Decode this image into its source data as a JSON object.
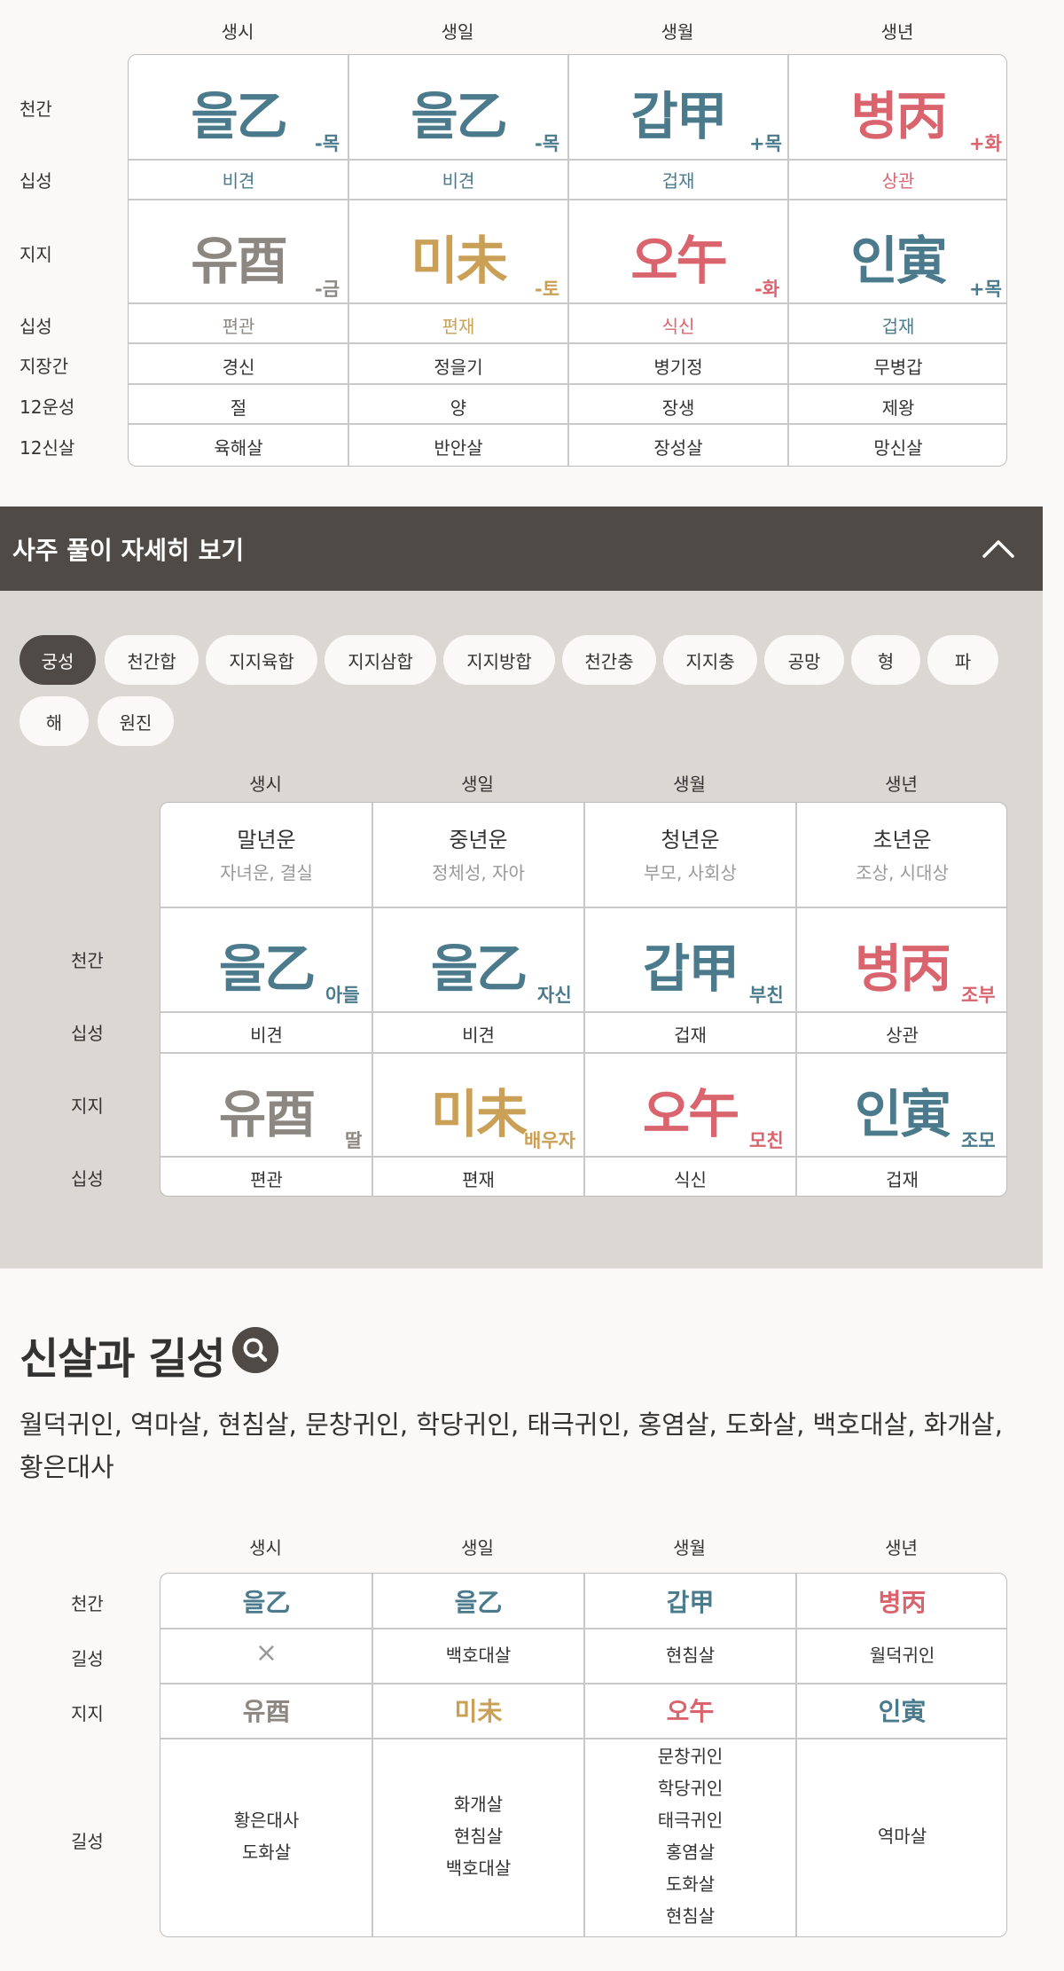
{
  "pillars": [
    "생시",
    "생일",
    "생월",
    "생년"
  ],
  "main_table": {
    "row_labels": [
      "천간",
      "십성",
      "지지",
      "십성",
      "지장간",
      "12운성",
      "12신살"
    ],
    "cheongan": [
      {
        "char": "을乙",
        "tag": "-목",
        "color": "#4a7a8c"
      },
      {
        "char": "을乙",
        "tag": "-목",
        "color": "#4a7a8c"
      },
      {
        "char": "갑甲",
        "tag": "+목",
        "color": "#4a7a8c"
      },
      {
        "char": "병丙",
        "tag": "+화",
        "color": "#d9646e"
      }
    ],
    "cheongan_sipseong": [
      "비견",
      "비견",
      "겁재",
      "상관"
    ],
    "jiji": [
      {
        "char": "유酉",
        "tag": "-금",
        "color": "#8c8780"
      },
      {
        "char": "미未",
        "tag": "-토",
        "color": "#c9a055"
      },
      {
        "char": "오午",
        "tag": "-화",
        "color": "#d9646e"
      },
      {
        "char": "인寅",
        "tag": "+목",
        "color": "#4a7a8c"
      }
    ],
    "jiji_sipseong": [
      "편관",
      "편재",
      "식신",
      "겁재"
    ],
    "jijanggan": [
      "경신",
      "정을기",
      "병기정",
      "무병갑"
    ],
    "unseong": [
      "절",
      "양",
      "장생",
      "제왕"
    ],
    "sinsal": [
      "육해살",
      "반안살",
      "장성살",
      "망신살"
    ]
  },
  "detail": {
    "title": "사주 풀이 자세히 보기",
    "chevron_icon": "chevron-up-icon",
    "chips": [
      "궁성",
      "천간합",
      "지지육합",
      "지지삼합",
      "지지방합",
      "천간충",
      "지지충",
      "공망",
      "형",
      "파",
      "해",
      "원진"
    ],
    "active_chip": "궁성",
    "row_labels": [
      "천간",
      "십성",
      "지지",
      "십성"
    ],
    "life_stages": [
      {
        "main": "말년운",
        "sub": "자녀운, 결실"
      },
      {
        "main": "중년운",
        "sub": "정체성, 자아"
      },
      {
        "main": "청년운",
        "sub": "부모, 사회상"
      },
      {
        "main": "초년운",
        "sub": "조상, 시대상"
      }
    ],
    "cheongan": [
      {
        "char": "을乙",
        "tag": "아들"
      },
      {
        "char": "을乙",
        "tag": "자신"
      },
      {
        "char": "갑甲",
        "tag": "부친"
      },
      {
        "char": "병丙",
        "tag": "조부"
      }
    ],
    "cheongan_sipseong": [
      "비견",
      "비견",
      "겁재",
      "상관"
    ],
    "jiji": [
      {
        "char": "유酉",
        "tag": "딸"
      },
      {
        "char": "미未",
        "tag": "배우자"
      },
      {
        "char": "오午",
        "tag": "모친"
      },
      {
        "char": "인寅",
        "tag": "조모"
      }
    ],
    "jiji_sipseong": [
      "편관",
      "편재",
      "식신",
      "겁재"
    ]
  },
  "sinsal_section": {
    "title": "신살과 길성",
    "search_icon": "search-icon",
    "summary": "월덕귀인, 역마살, 현침살, 문창귀인, 학당귀인, 태극귀인, 홍염살, 도화살, 백호대살, 화개살, 황은대사",
    "row_labels": [
      "천간",
      "길성",
      "지지",
      "길성"
    ],
    "cheongan": [
      "을乙",
      "을乙",
      "갑甲",
      "병丙"
    ],
    "cheongan_gilseong": [
      "×",
      "백호대살",
      "현침살",
      "월덕귀인"
    ],
    "jiji": [
      "유酉",
      "미未",
      "오午",
      "인寅"
    ],
    "jiji_gilseong": [
      [
        "황은대사",
        "도화살"
      ],
      [
        "화개살",
        "현침살",
        "백호대살"
      ],
      [
        "문창귀인",
        "학당귀인",
        "태극귀인",
        "홍염살",
        "도화살",
        "현침살"
      ],
      [
        "역마살"
      ]
    ]
  }
}
